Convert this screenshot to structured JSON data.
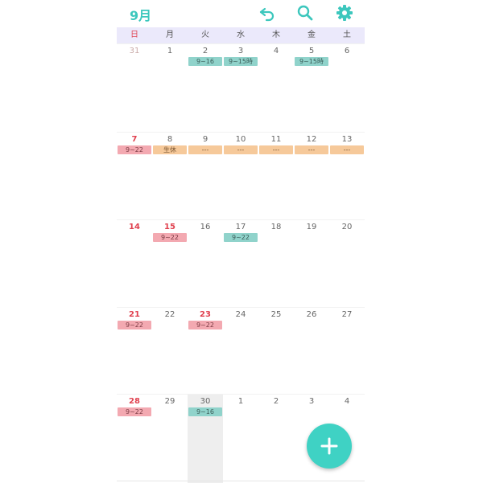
{
  "header": {
    "month_label": "9月",
    "icons": [
      "undo-icon",
      "search-icon",
      "settings-icon"
    ],
    "accent_color": "#3cc7bd"
  },
  "weekdays": [
    "日",
    "月",
    "火",
    "水",
    "木",
    "金",
    "土"
  ],
  "weeks": [
    [
      {
        "day": "31",
        "style": "muted"
      },
      {
        "day": "1"
      },
      {
        "day": "2",
        "event": {
          "label": "9~16",
          "color": "teal"
        }
      },
      {
        "day": "3",
        "event": {
          "label": "9~15時",
          "color": "teal"
        }
      },
      {
        "day": "4"
      },
      {
        "day": "5",
        "event": {
          "label": "9~15時",
          "color": "teal"
        }
      },
      {
        "day": "6"
      }
    ],
    [
      {
        "day": "7",
        "style": "red",
        "event": {
          "label": "9~22",
          "color": "pink"
        }
      },
      {
        "day": "8",
        "event": {
          "label": "生休",
          "color": "orange"
        }
      },
      {
        "day": "9",
        "event": {
          "label": "---",
          "color": "orange"
        }
      },
      {
        "day": "10",
        "event": {
          "label": "---",
          "color": "orange"
        }
      },
      {
        "day": "11",
        "event": {
          "label": "---",
          "color": "orange"
        }
      },
      {
        "day": "12",
        "event": {
          "label": "---",
          "color": "orange"
        }
      },
      {
        "day": "13",
        "event": {
          "label": "---",
          "color": "orange"
        }
      }
    ],
    [
      {
        "day": "14",
        "style": "red"
      },
      {
        "day": "15",
        "style": "red",
        "event": {
          "label": "9~22",
          "color": "pink"
        }
      },
      {
        "day": "16"
      },
      {
        "day": "17",
        "event": {
          "label": "9~22",
          "color": "teal"
        }
      },
      {
        "day": "18"
      },
      {
        "day": "19"
      },
      {
        "day": "20"
      }
    ],
    [
      {
        "day": "21",
        "style": "red",
        "event": {
          "label": "9~22",
          "color": "pink"
        }
      },
      {
        "day": "22"
      },
      {
        "day": "23",
        "style": "red",
        "event": {
          "label": "9~22",
          "color": "pink"
        }
      },
      {
        "day": "24"
      },
      {
        "day": "25"
      },
      {
        "day": "26"
      },
      {
        "day": "27"
      }
    ],
    [
      {
        "day": "28",
        "style": "red",
        "event": {
          "label": "9~22",
          "color": "pink"
        }
      },
      {
        "day": "29"
      },
      {
        "day": "30",
        "today": true,
        "event": {
          "label": "9~16",
          "color": "teal"
        }
      },
      {
        "day": "1"
      },
      {
        "day": "2"
      },
      {
        "day": "3"
      },
      {
        "day": "4"
      }
    ]
  ],
  "fab": {
    "icon": "plus-icon",
    "color": "#3fd2c4"
  }
}
